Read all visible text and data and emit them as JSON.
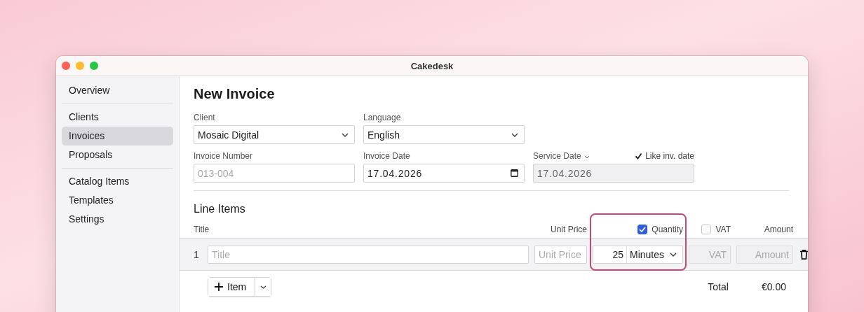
{
  "window": {
    "title": "Cakedesk"
  },
  "sidebar": {
    "groups": [
      {
        "items": [
          {
            "label": "Overview",
            "selected": false
          }
        ]
      },
      {
        "items": [
          {
            "label": "Clients",
            "selected": false
          },
          {
            "label": "Invoices",
            "selected": true
          },
          {
            "label": "Proposals",
            "selected": false
          }
        ]
      },
      {
        "items": [
          {
            "label": "Catalog Items",
            "selected": false
          },
          {
            "label": "Templates",
            "selected": false
          },
          {
            "label": "Settings",
            "selected": false
          }
        ]
      }
    ]
  },
  "form": {
    "heading": "New Invoice",
    "field_rows": [
      {
        "fields": [
          {
            "label": "Client",
            "kind": "select",
            "value": "Mosaic Digital"
          },
          {
            "label": "Language",
            "kind": "select",
            "value": "English"
          }
        ]
      },
      {
        "fields": [
          {
            "label": "Invoice Number",
            "kind": "text",
            "placeholder": "013-004"
          },
          {
            "label": "Invoice Date",
            "kind": "date",
            "value": "17.04.2026"
          },
          {
            "label": "Service Date",
            "kind": "locked",
            "value": "17.04.2026",
            "label_menu": true,
            "option": {
              "label": "Like inv. date",
              "checked": true
            }
          }
        ]
      }
    ]
  },
  "line_items": {
    "heading": "Line Items",
    "columns": [
      {
        "label": "Title",
        "highlighted": false
      },
      {
        "label": "Unit Price",
        "highlighted": false
      },
      {
        "label": "Quantity",
        "checked": true,
        "highlighted": true
      },
      {
        "label": "VAT",
        "checked": false,
        "highlighted": false
      },
      {
        "label": "Amount",
        "highlighted": false
      }
    ],
    "rows": [
      {
        "number": "1",
        "cells": [
          {
            "kind": "input",
            "placeholder": "Title",
            "disabled": false
          },
          {
            "kind": "input",
            "placeholder": "Unit Price",
            "disabled": false
          },
          {
            "kind": "quantity",
            "value": "25",
            "unit": "Minutes"
          },
          {
            "kind": "input",
            "placeholder": "VAT",
            "disabled": true
          },
          {
            "kind": "input",
            "placeholder": "Amount",
            "disabled": true
          }
        ]
      }
    ],
    "add_button": "Item",
    "total_label": "Total",
    "total": "€0.00"
  }
}
